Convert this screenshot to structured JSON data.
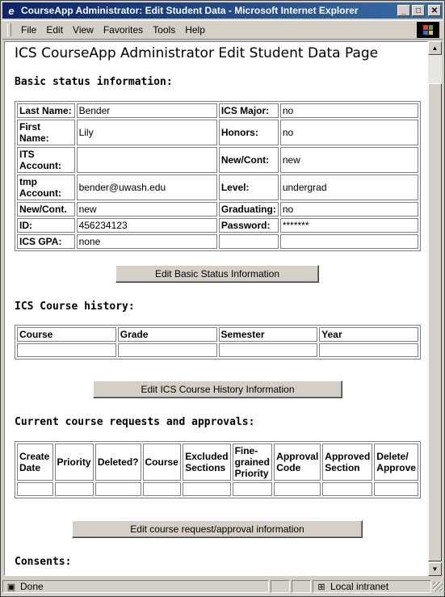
{
  "window": {
    "title": "CourseApp Administrator: Edit Student Data - Microsoft Internet Explorer",
    "controls": {
      "minimize": "_",
      "maximize": "□",
      "close": "✕"
    }
  },
  "menu": {
    "file": "File",
    "edit": "Edit",
    "view": "View",
    "favorites": "Favorites",
    "tools": "Tools",
    "help": "Help"
  },
  "page": {
    "title": "ICS CourseApp Administrator Edit Student Data Page",
    "basic_heading": "Basic status information:",
    "basic_rows": [
      {
        "l1": "Last Name:",
        "v1": "Bender",
        "l2": "ICS Major:",
        "v2": "no"
      },
      {
        "l1": "First Name:",
        "v1": "Lily",
        "l2": "Honors:",
        "v2": "no"
      },
      {
        "l1": "ITS Account:",
        "v1": "",
        "l2": "New/Cont:",
        "v2": "new"
      },
      {
        "l1": "tmp Account:",
        "v1": "bender@uwash.edu",
        "l2": "Level:",
        "v2": "undergrad"
      },
      {
        "l1": "New/Cont.",
        "v1": "new",
        "l2": "Graduating:",
        "v2": "no"
      },
      {
        "l1": "ID:",
        "v1": "456234123",
        "l2": "Password:",
        "v2": "*******"
      },
      {
        "l1": "ICS GPA:",
        "v1": "none",
        "l2": "",
        "v2": ""
      }
    ],
    "edit_basic_button": "Edit Basic Status Information",
    "history_heading": "ICS Course history:",
    "history_columns": [
      "Course",
      "Grade",
      "Semester",
      "Year"
    ],
    "edit_history_button": "Edit ICS Course History Information",
    "requests_heading": "Current course requests and approvals:",
    "requests_columns": [
      "Create Date",
      "Priority",
      "Deleted?",
      "Course",
      "Excluded Sections",
      "Fine-grained Priority",
      "Approval Code",
      "Approved Section",
      "Delete/ Approve"
    ],
    "edit_requests_button": "Edit course request/approval information",
    "consents_heading": "Consents:"
  },
  "status": {
    "text": "Done",
    "zone": "Local intranet"
  }
}
